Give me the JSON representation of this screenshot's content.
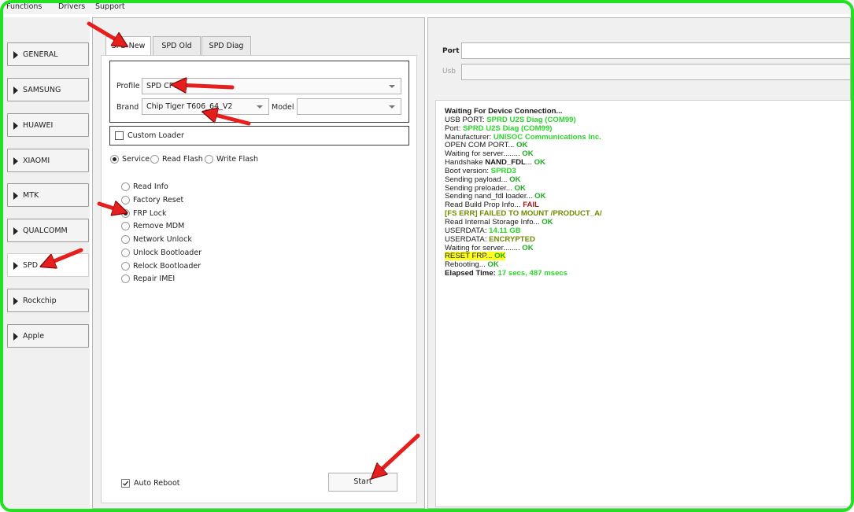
{
  "menu": [
    "Functions",
    "Drivers",
    "Support"
  ],
  "sidebar": [
    {
      "label": "GENERAL",
      "active": false
    },
    {
      "label": "SAMSUNG",
      "active": false
    },
    {
      "label": "HUAWEI",
      "active": false
    },
    {
      "label": "XIAOMI",
      "active": false
    },
    {
      "label": "MTK",
      "active": false
    },
    {
      "label": "QUALCOMM",
      "active": false
    },
    {
      "label": "SPD",
      "active": true
    },
    {
      "label": "Rockchip",
      "active": false
    },
    {
      "label": "Apple",
      "active": false
    }
  ],
  "tabs": [
    {
      "label": "SPD New",
      "active": true
    },
    {
      "label": "SPD Old",
      "active": false
    },
    {
      "label": "SPD Diag",
      "active": false
    }
  ],
  "profile": {
    "label": "Profile",
    "value": "SPD CPU"
  },
  "brand": {
    "label": "Brand",
    "value": "Chip Tiger T606_64_V2"
  },
  "model": {
    "label": "Model",
    "value": ""
  },
  "custom_loader": {
    "label": "Custom Loader",
    "checked": false
  },
  "mode": [
    {
      "label": "Service",
      "selected": true
    },
    {
      "label": "Read  Flash",
      "selected": false
    },
    {
      "label": "Write Flash",
      "selected": false
    }
  ],
  "operations": [
    {
      "label": "Read Info",
      "selected": false
    },
    {
      "label": "Factory Reset",
      "selected": false
    },
    {
      "label": "FRP Lock",
      "selected": true
    },
    {
      "label": "Remove MDM",
      "selected": false
    },
    {
      "label": "Network Unlock",
      "selected": false
    },
    {
      "label": "Unlock Bootloader",
      "selected": false
    },
    {
      "label": "Relock Bootloader",
      "selected": false
    },
    {
      "label": "Repair IMEI",
      "selected": false
    }
  ],
  "auto_reboot": {
    "label": "Auto Reboot",
    "checked": true
  },
  "start_label": "Start",
  "port": {
    "label": "Port",
    "value": ""
  },
  "usb": {
    "label": "Usb",
    "value": ""
  },
  "log": [
    [
      {
        "t": "Waiting For Device Connection...",
        "s": "b"
      }
    ],
    [
      {
        "t": "USB PORT: ",
        "s": ""
      },
      {
        "t": "SPRD U2S Diag (COM99)",
        "s": "g"
      }
    ],
    [
      {
        "t": "Port: ",
        "s": ""
      },
      {
        "t": "SPRD U2S Diag (COM99)",
        "s": "g"
      }
    ],
    [
      {
        "t": "Manufacturer: ",
        "s": ""
      },
      {
        "t": "UNISOC Communications Inc.",
        "s": "g"
      }
    ],
    [
      {
        "t": "OPEN COM PORT... ",
        "s": ""
      },
      {
        "t": "OK",
        "s": "ok"
      }
    ],
    [
      {
        "t": "Waiting for server........ ",
        "s": ""
      },
      {
        "t": "OK",
        "s": "ok"
      }
    ],
    [
      {
        "t": "Handshake ",
        "s": ""
      },
      {
        "t": "NAND_FDL",
        "s": "b"
      },
      {
        "t": "... ",
        "s": ""
      },
      {
        "t": "OK",
        "s": "ok"
      }
    ],
    [
      {
        "t": "Boot version: ",
        "s": ""
      },
      {
        "t": "SPRD3",
        "s": "g"
      }
    ],
    [
      {
        "t": "Sending payload... ",
        "s": ""
      },
      {
        "t": "OK",
        "s": "ok"
      }
    ],
    [
      {
        "t": "Sending preloader... ",
        "s": ""
      },
      {
        "t": "OK",
        "s": "ok"
      }
    ],
    [
      {
        "t": "Sending nand_fdl loader... ",
        "s": ""
      },
      {
        "t": "OK",
        "s": "ok"
      }
    ],
    [
      {
        "t": "Read Build Prop Info... ",
        "s": ""
      },
      {
        "t": "FAIL",
        "s": "fail"
      }
    ],
    [
      {
        "t": "   [FS ERR] FAILED TO MOUNT /PRODUCT_A/",
        "s": "ol"
      }
    ],
    [
      {
        "t": "Read Internal Storage Info... ",
        "s": ""
      },
      {
        "t": "OK",
        "s": "ok"
      }
    ],
    [
      {
        "t": "USERDATA: ",
        "s": ""
      },
      {
        "t": "14.11 GB",
        "s": "g"
      }
    ],
    [
      {
        "t": "USERDATA: ",
        "s": ""
      },
      {
        "t": "ENCRYPTED",
        "s": "ol"
      }
    ],
    [
      {
        "t": "Waiting for server........ ",
        "s": ""
      },
      {
        "t": "OK",
        "s": "ok"
      }
    ],
    [
      {
        "t": "RESET FRP... ",
        "s": "hl"
      },
      {
        "t": "OK",
        "s": "ok hl"
      }
    ],
    [
      {
        "t": "Rebooting... ",
        "s": ""
      },
      {
        "t": "OK",
        "s": "ok"
      }
    ],
    [
      {
        "t": "Elapsed Time: ",
        "s": "b"
      },
      {
        "t": "17 secs, 487 msecs",
        "s": "g"
      }
    ]
  ],
  "colors": {
    "frame": "#22e022",
    "arrow": "#e61e1e",
    "ok": "#22aa22",
    "highlight": "#ffff20"
  }
}
